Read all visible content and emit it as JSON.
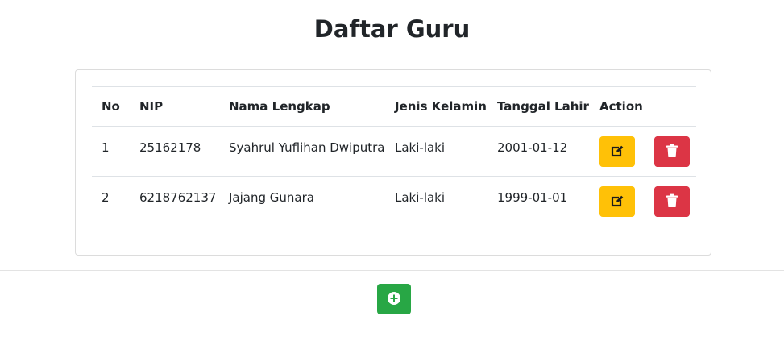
{
  "page": {
    "title": "Daftar Guru"
  },
  "table": {
    "headers": {
      "no": "No",
      "nip": "NIP",
      "nama": "Nama Lengkap",
      "jenis_kelamin": "Jenis Kelamin",
      "tanggal_lahir": "Tanggal Lahir",
      "action": "Action"
    },
    "rows": [
      {
        "no": "1",
        "nip": "25162178",
        "nama": "Syahrul Yuflihan Dwiputra",
        "jenis_kelamin": "Laki-laki",
        "tanggal_lahir": "2001-01-12"
      },
      {
        "no": "2",
        "nip": "6218762137",
        "nama": "Jajang Gunara",
        "jenis_kelamin": "Laki-laki",
        "tanggal_lahir": "1999-01-01"
      }
    ]
  },
  "icons": {
    "edit": "edit-icon",
    "delete": "trash-icon",
    "add": "plus-circle-icon"
  },
  "colors": {
    "edit_button": "#ffc107",
    "delete_button": "#dc3545",
    "add_button": "#28a745"
  }
}
